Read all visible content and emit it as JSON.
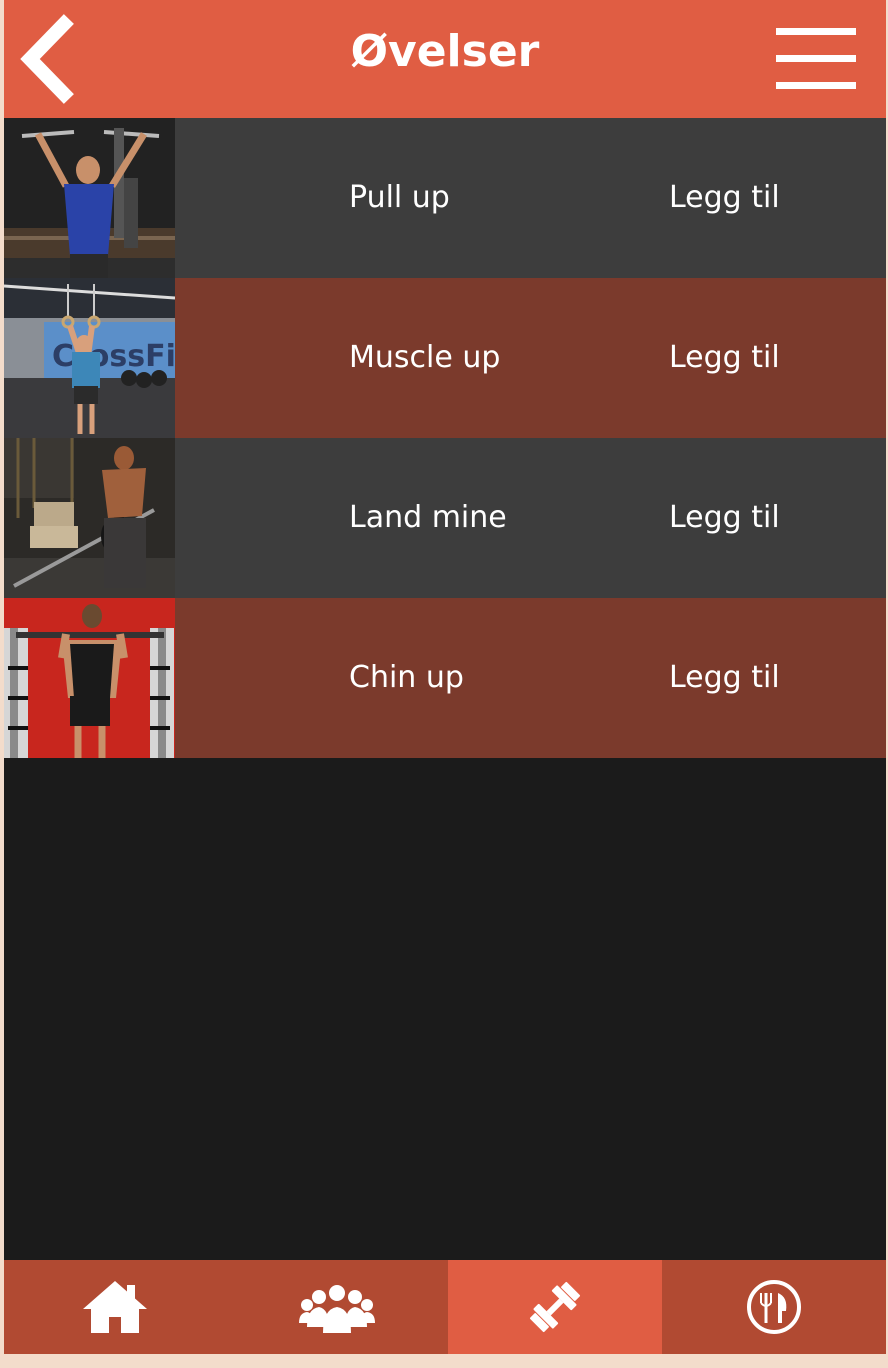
{
  "header": {
    "title": "Øvelser",
    "back_icon": "chevron-left-icon",
    "menu_icon": "hamburger-menu-icon"
  },
  "exercises": [
    {
      "name": "Pull up",
      "action": "Legg til",
      "photo": "man doing pull-up on machine"
    },
    {
      "name": "Muscle up",
      "action": "Legg til",
      "photo": "man hanging on gymnastic rings"
    },
    {
      "name": "Land mine",
      "action": "Legg til",
      "photo": "man performing landmine barbell rotation"
    },
    {
      "name": "Chin up",
      "action": "Legg til",
      "photo": "man doing chin-up at rack"
    }
  ],
  "bottom_nav": {
    "items": [
      {
        "icon": "home-icon",
        "active": false
      },
      {
        "icon": "group-icon",
        "active": false
      },
      {
        "icon": "dumbbell-icon",
        "active": true
      },
      {
        "icon": "restaurant-icon",
        "active": false
      }
    ]
  },
  "colors": {
    "accent": "#e05d43",
    "row_dark": "#3d3d3d",
    "row_brown": "#7b3a2c",
    "nav_bg": "#b14a32",
    "background": "#1b1b1b"
  }
}
